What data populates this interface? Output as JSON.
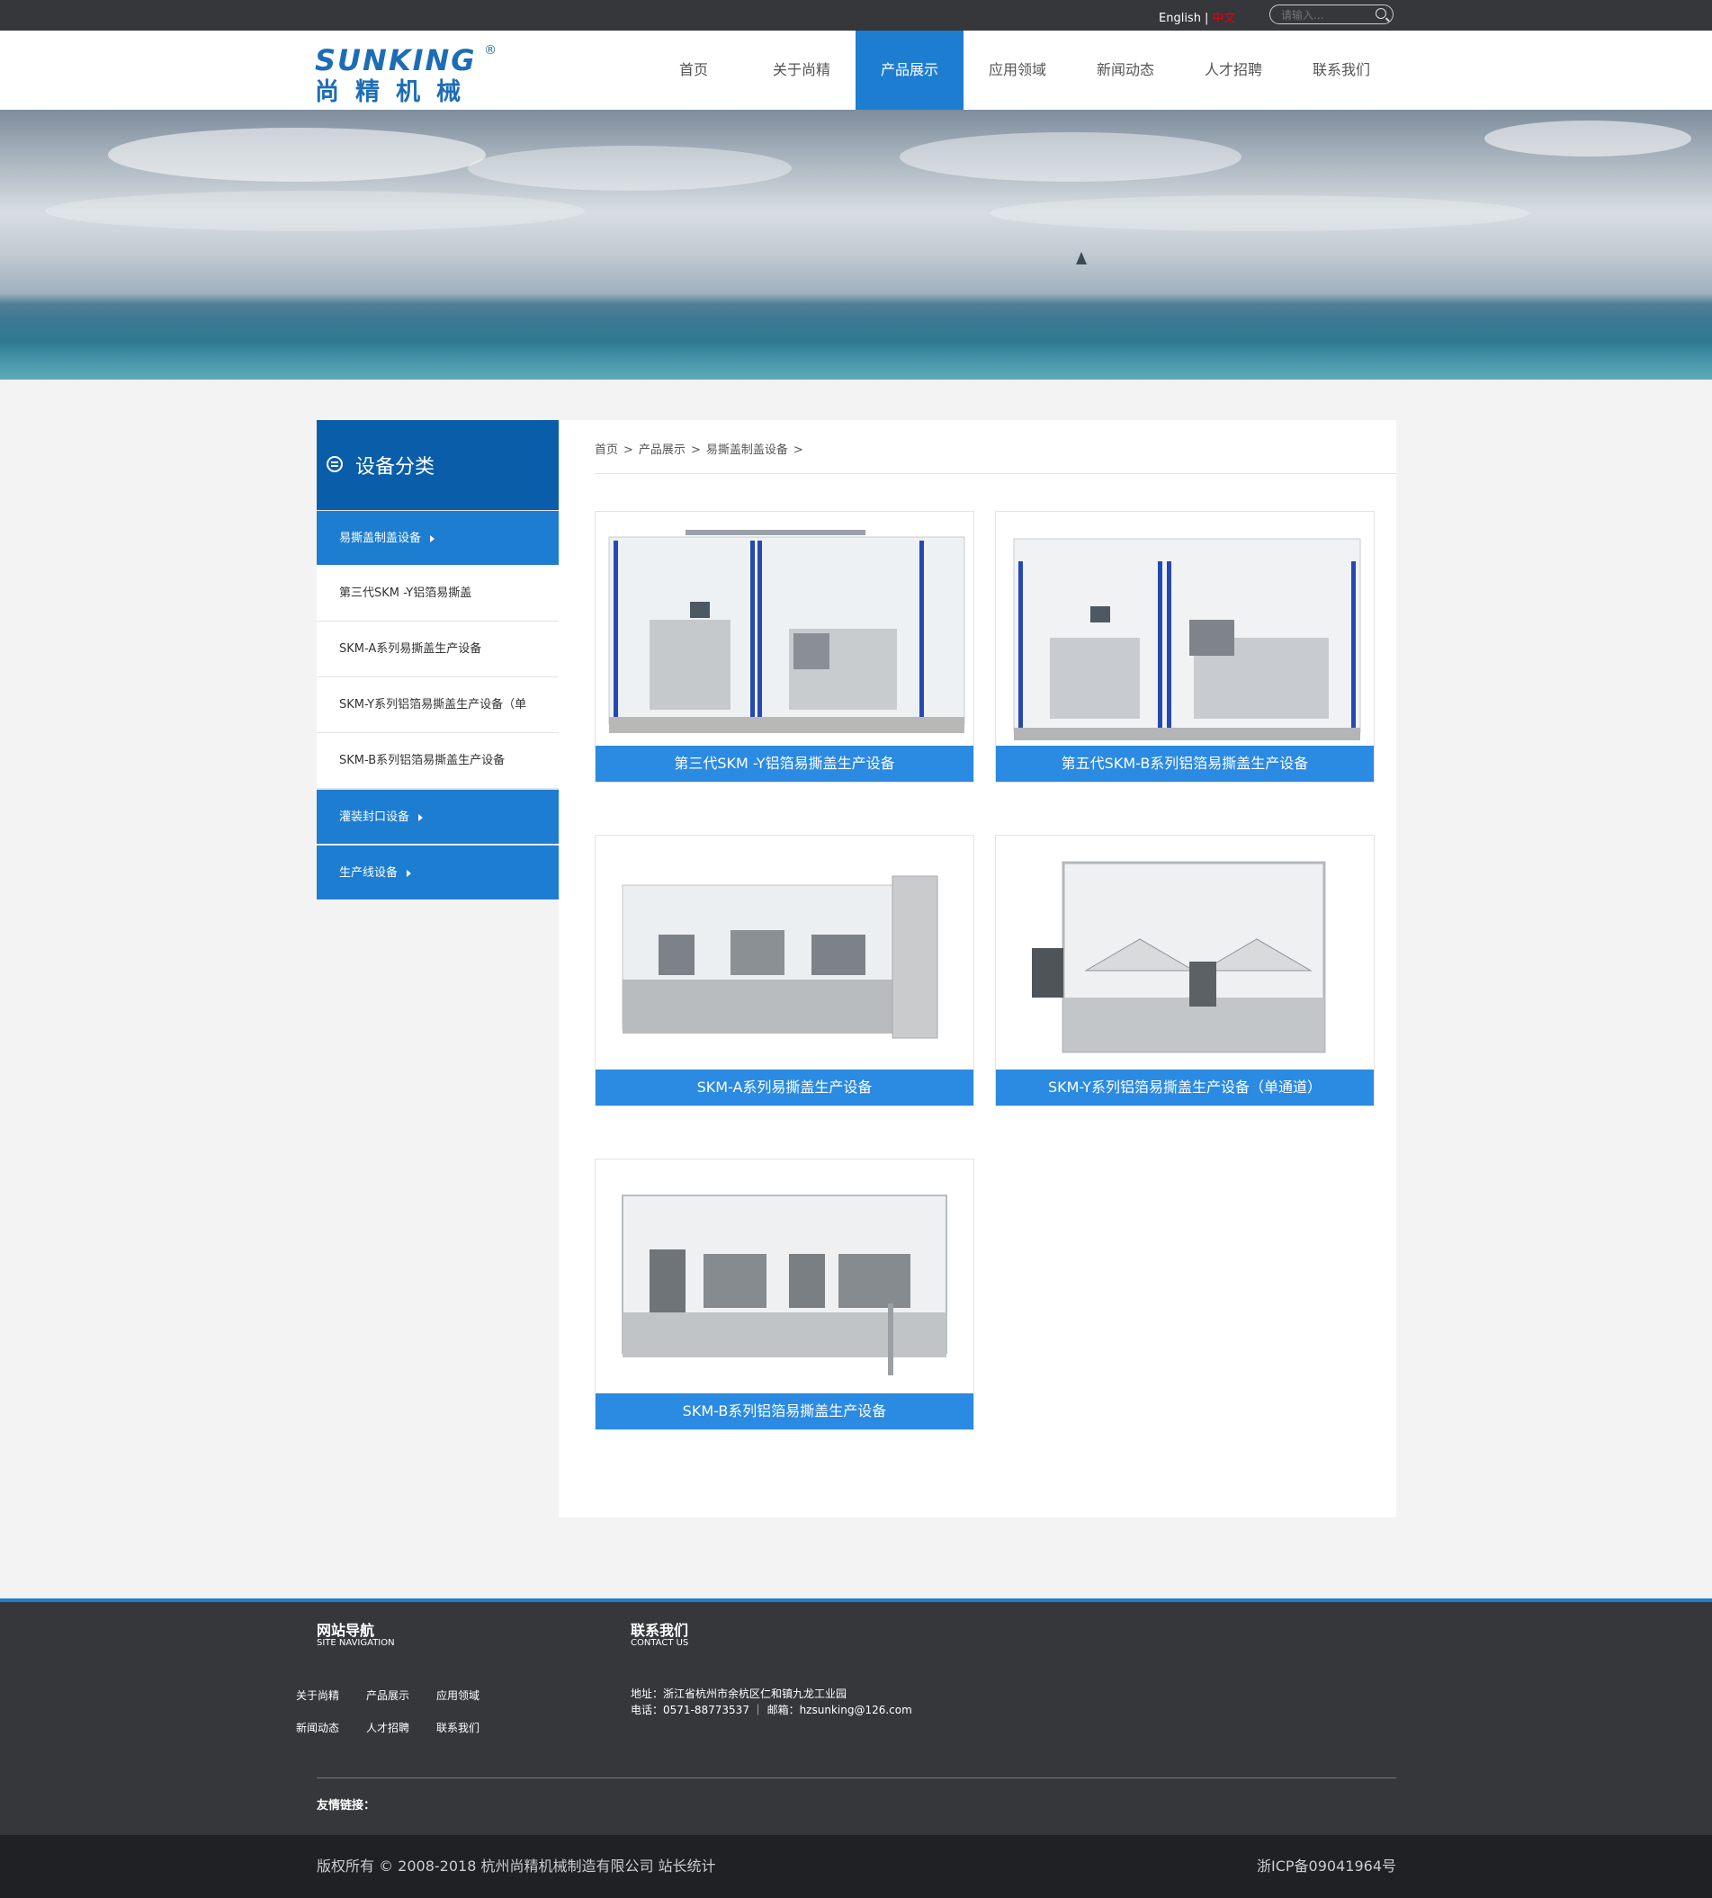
{
  "topbar": {
    "lang_en": "English",
    "lang_zh": "中文",
    "search_placeholder": "请输入..."
  },
  "brand": {
    "name_en": "SUNKING",
    "reg": "®",
    "name_cn": "尚精机械"
  },
  "nav": [
    {
      "label": "首页",
      "active": false
    },
    {
      "label": "关于尚精",
      "active": false
    },
    {
      "label": "产品展示",
      "active": true
    },
    {
      "label": "应用领域",
      "active": false
    },
    {
      "label": "新闻动态",
      "active": false
    },
    {
      "label": "人才招聘",
      "active": false
    },
    {
      "label": "联系我们",
      "active": false
    }
  ],
  "sidebar": {
    "title": "设备分类",
    "items": [
      {
        "label": "易撕盖制盖设备",
        "type": "category"
      },
      {
        "label": "第三代SKM -Y铝箔易撕盖",
        "type": "sub"
      },
      {
        "label": "SKM-A系列易撕盖生产设备",
        "type": "sub"
      },
      {
        "label": "SKM-Y系列铝箔易撕盖生产设备（单",
        "type": "sub"
      },
      {
        "label": "SKM-B系列铝箔易撕盖生产设备",
        "type": "sub"
      },
      {
        "label": "灌装封口设备",
        "type": "category"
      },
      {
        "label": "生产线设备",
        "type": "category"
      }
    ]
  },
  "breadcrumb": [
    "首页",
    "产品展示",
    "易撕盖制盖设备"
  ],
  "products": [
    {
      "caption": "第三代SKM -Y铝箔易撕盖生产设备"
    },
    {
      "caption": "第五代SKM-B系列铝箔易撕盖生产设备"
    },
    {
      "caption": "SKM-A系列易撕盖生产设备"
    },
    {
      "caption": "SKM-Y系列铝箔易撕盖生产设备（单通道）"
    },
    {
      "caption": "SKM-B系列铝箔易撕盖生产设备"
    }
  ],
  "footer": {
    "nav_title": "网站导航",
    "nav_sub": "SITE NAVIGATION",
    "contact_title": "联系我们",
    "contact_sub": "CONTACT US",
    "links": [
      "关于尚精",
      "产品展示",
      "应用领域",
      "新闻动态",
      "人才招聘",
      "联系我们"
    ],
    "address": "地址：浙江省杭州市余杭区仁和镇九龙工业园",
    "phone_line": "电话：0571-88773537 ｜ 邮箱：hzsunking@126.com",
    "friends_label": "友情链接："
  },
  "copyright": {
    "left": "版权所有 © 2008-2018 杭州尚精机械制造有限公司 站长统计",
    "right": "浙ICP备09041964号"
  },
  "colors": {
    "accent": "#1d7dd1",
    "dark": "#35373b",
    "sidebar_head": "#0a5da8",
    "caption": "#2b8ae2"
  }
}
